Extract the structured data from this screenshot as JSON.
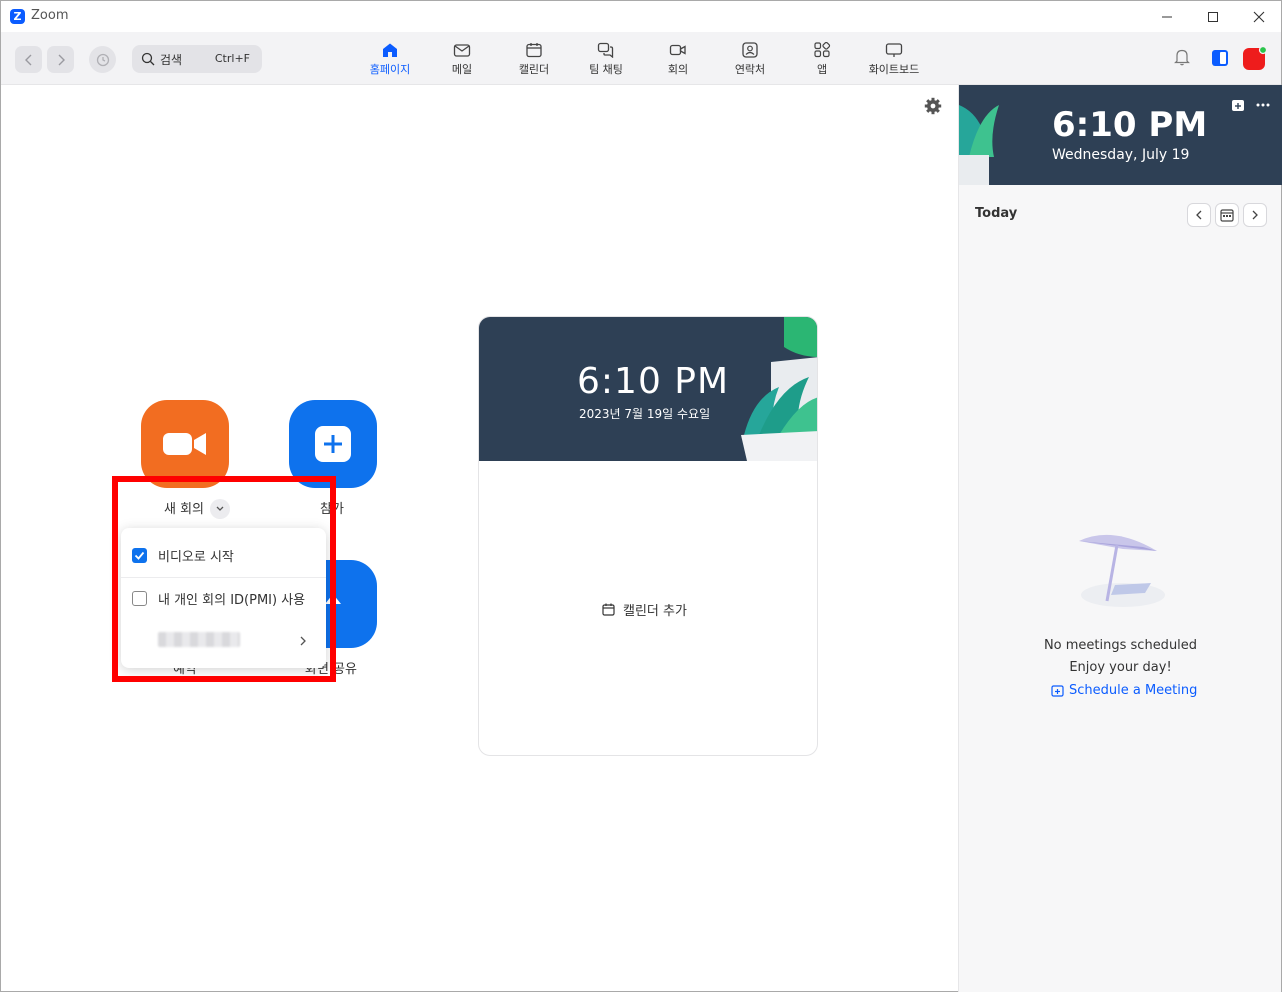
{
  "window": {
    "title": "Zoom",
    "logo_letter": "Z"
  },
  "toolbar": {
    "search_placeholder": "검색",
    "search_shortcut": "Ctrl+F",
    "tabs": [
      {
        "label": "홈페이지",
        "icon": "home-icon",
        "active": true
      },
      {
        "label": "메일",
        "icon": "mail-icon"
      },
      {
        "label": "캘린더",
        "icon": "calendar-icon"
      },
      {
        "label": "팀 채팅",
        "icon": "chat-icon"
      },
      {
        "label": "회의",
        "icon": "video-icon"
      },
      {
        "label": "연락처",
        "icon": "contacts-icon"
      },
      {
        "label": "앱",
        "icon": "apps-icon"
      },
      {
        "label": "화이트보드",
        "icon": "whiteboard-icon"
      }
    ]
  },
  "home": {
    "new_meeting_label": "새 회의",
    "join_label": "참가",
    "schedule_label": "예약",
    "share_screen_label": "화면 공유",
    "new_meeting_dropdown": {
      "items": [
        {
          "label": "비디오로 시작",
          "checked": true
        },
        {
          "label": "내 개인 회의 ID(PMI) 사용",
          "checked": false
        }
      ]
    }
  },
  "clock_card": {
    "time": "6:10 PM",
    "date": "2023년 7월 19일 수요일",
    "add_calendar_label": "캘린더 추가"
  },
  "right_panel": {
    "time": "6:10 PM",
    "date": "Wednesday, July 19",
    "today_label": "Today",
    "empty_title": "No meetings scheduled",
    "empty_subtitle": "Enjoy your day!",
    "schedule_link": "Schedule a Meeting"
  },
  "colors": {
    "accent": "#0b5cff",
    "orange": "#f26d21",
    "blue": "#0e72ed",
    "hero": "#2e4055",
    "highlight": "#ff0000"
  }
}
